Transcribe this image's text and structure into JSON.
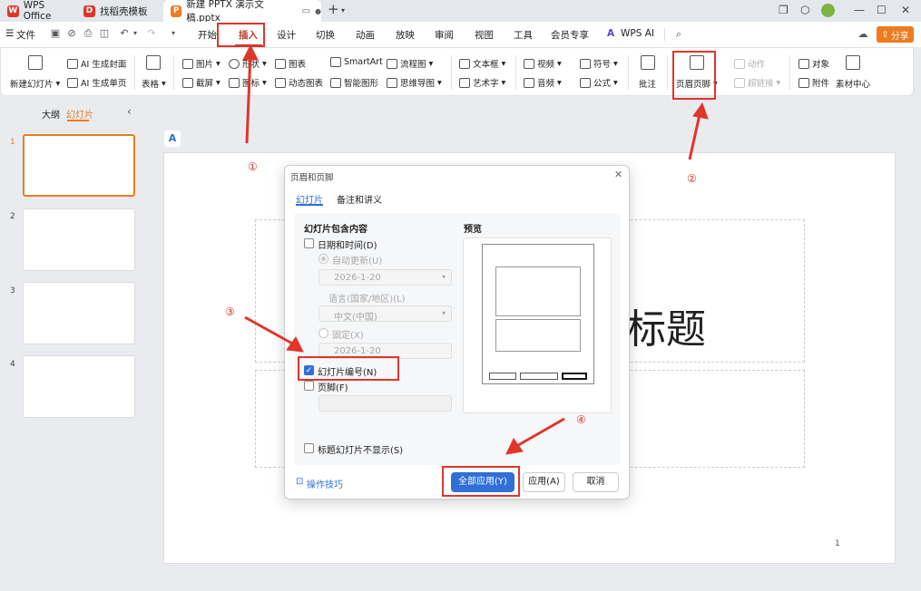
{
  "tabs": [
    {
      "label": "WPS Office",
      "logo": "W"
    },
    {
      "label": "找稻壳模板",
      "logo": "D"
    },
    {
      "label": "新建 PPTX 演示文稿.pptx",
      "logo": "P"
    }
  ],
  "menu": {
    "file": "文件",
    "items": [
      "开始",
      "插入",
      "设计",
      "切换",
      "动画",
      "放映",
      "审阅",
      "视图",
      "工具",
      "会员专享",
      "WPS AI"
    ],
    "share": "分享"
  },
  "ribbon": {
    "new_slide": "新建幻灯片",
    "ai_cover": "AI 生成封面",
    "ai_single": "AI 生成单页",
    "table": "表格",
    "picture": "图片",
    "screenshot": "截屏",
    "shape": "形状",
    "icon": "图标",
    "chart": "图表",
    "dynamic_chart": "动态图表",
    "smartart": "SmartArt",
    "smart_graphic": "智能图形",
    "flowchart": "流程图",
    "mindmap": "思维导图",
    "textbox": "文本框",
    "wordart": "艺术字",
    "video": "视频",
    "audio": "音频",
    "symbol": "符号",
    "formula": "公式",
    "comment": "批注",
    "header_footer": "页眉页脚",
    "action": "动作",
    "hyperlink": "超链接",
    "object": "对象",
    "attachment": "附件",
    "material": "素材中心"
  },
  "left_panel": {
    "tab_outline": "大纲",
    "tab_slides": "幻灯片",
    "thumbnails": [
      "1",
      "2",
      "3",
      "4"
    ]
  },
  "slide": {
    "title_fragment": "标题",
    "page_number": "1"
  },
  "dialog": {
    "title": "页眉和页脚",
    "tab_slide": "幻灯片",
    "tab_notes": "备注和讲义",
    "section_title": "幻灯片包含内容",
    "date_time": "日期和时间(D)",
    "auto_update": "自动更新(U)",
    "auto_date": "2026-1-20",
    "language_label": "语言(国家/地区)(L)",
    "language": "中文(中国)",
    "fixed": "固定(X)",
    "fixed_date": "2026-1-20",
    "slide_number": "幻灯片编号(N)",
    "footer": "页脚(F)",
    "hide_title_slide": "标题幻灯片不显示(S)",
    "preview": "预览",
    "tips": "操作技巧",
    "apply_all": "全部应用(Y)",
    "apply": "应用(A)",
    "cancel": "取消"
  },
  "annotations": [
    "①",
    "②",
    "③",
    "④"
  ],
  "colors": {
    "accent": "#2f6fd6",
    "annotation": "#e0352b",
    "share": "#f07b20",
    "active_tab_text": "#c0392b"
  }
}
